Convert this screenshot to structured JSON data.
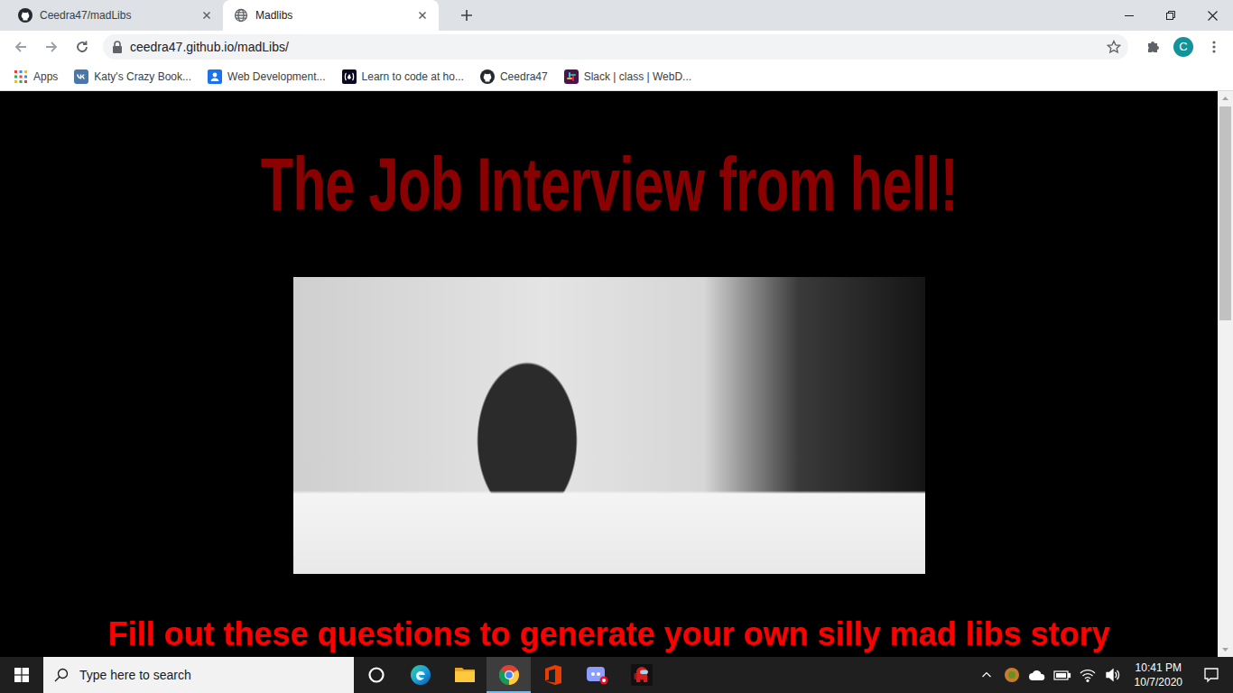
{
  "tabs": [
    {
      "label": "Ceedra47/madLibs",
      "selected": false,
      "kind": "github"
    },
    {
      "label": "Madlibs",
      "selected": true,
      "kind": "globe"
    }
  ],
  "address_bar": {
    "url": "ceedra47.github.io/madLibs/"
  },
  "profile": {
    "initial": "C"
  },
  "bookmarks": [
    {
      "label": "Apps",
      "kind": "apps"
    },
    {
      "label": "Katy's Crazy Book...",
      "kind": "vk"
    },
    {
      "label": "Web Development...",
      "kind": "sites"
    },
    {
      "label": "Learn to code at ho...",
      "kind": "freecodecamp"
    },
    {
      "label": "Ceedra47",
      "kind": "github"
    },
    {
      "label": "Slack | class | WebD...",
      "kind": "slack"
    }
  ],
  "page": {
    "title": "The Job Interview from hell!",
    "subtitle": "Fill out these questions to generate your own silly mad libs story"
  },
  "scrollbar": {
    "level": 0.4
  },
  "taskbar": {
    "search": {
      "placeholder": "Type here to search"
    },
    "apps": [
      {
        "kind": "cortana",
        "selected": false
      },
      {
        "kind": "edge",
        "selected": false
      },
      {
        "kind": "explorer",
        "selected": false
      },
      {
        "kind": "chrome",
        "selected": true
      },
      {
        "kind": "office",
        "selected": false
      },
      {
        "kind": "discord",
        "selected": false
      },
      {
        "kind": "amongus",
        "selected": false
      }
    ],
    "time": "10:41 PM",
    "date": "10/7/2020"
  }
}
